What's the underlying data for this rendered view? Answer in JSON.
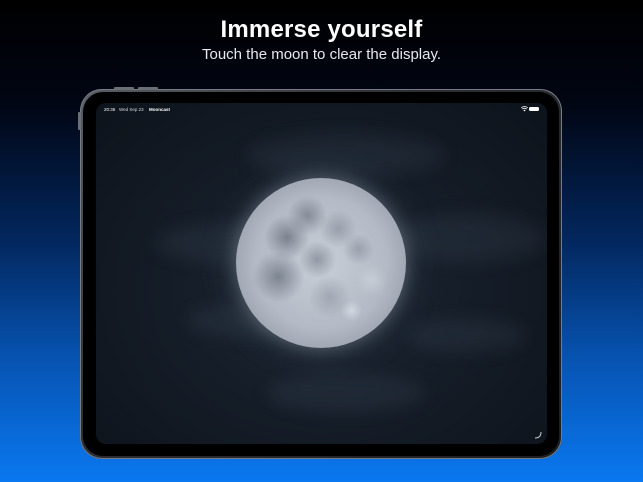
{
  "promo": {
    "headline": "Immerse yourself",
    "subhead": "Touch the moon to clear the display."
  },
  "status_bar": {
    "time": "20:36",
    "date": "Wed Sep 23",
    "app_name": "Mooncast",
    "battery_level": 1.0
  },
  "icons": {
    "wifi": "wifi-icon",
    "battery": "battery-icon",
    "corner": "resize-corner-icon"
  },
  "colors": {
    "background_top": "#000000",
    "background_bottom": "#0a78f0",
    "screen_sky": "#151d28",
    "moon": "#b3bac5"
  }
}
